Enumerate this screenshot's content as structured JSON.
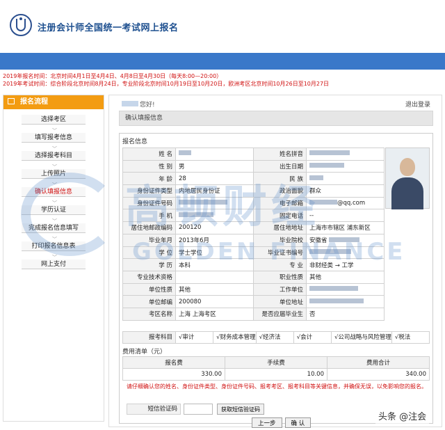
{
  "header": {
    "site_title": "注册会计师全国统一考试网上报名"
  },
  "notice": {
    "line1": "2019年报名时间：北京时间4月1日至4月4日、4月8日至4月30日（每天8:00—20:00）",
    "line2": "2019年考试时间：综合阶段北京时间8月24日，专业阶段北京时间10月19日至10月20日，欧洲考区北京时间10月26日至10月27日"
  },
  "sidebar": {
    "title": "报名流程",
    "steps": [
      "选择考区",
      "填写报考信息",
      "选择报考科目",
      "上传照片",
      "确认填报信息",
      "学历认证",
      "完成报名信息填写",
      "打印报名信息表",
      "网上支付"
    ],
    "active_index": 4
  },
  "main": {
    "greeting": "您好!",
    "logout": "退出登录",
    "confirm_title": "确认填报信息",
    "section_title": "报名信息",
    "fields": {
      "name_lbl": "姓 名",
      "pinyin_lbl": "姓名拼音",
      "gender_lbl": "性 别",
      "gender": "男",
      "dob_lbl": "出生日期",
      "age_lbl": "年 龄",
      "age": "28",
      "ethnic_lbl": "民 族",
      "idtype_lbl": "身份证件类型",
      "idtype": "内地居民身份证",
      "political_lbl": "政治面貌",
      "political": "群众",
      "idno_lbl": "身份证件号码",
      "email_lbl": "电子邮箱",
      "email_suffix": "@qq.com",
      "mobile_lbl": "手 机",
      "phone_lbl": "固定电话",
      "phone": "--",
      "zip_lbl": "居住地邮政编码",
      "zip": "200120",
      "addr_lbl": "居住地地址",
      "addr_prefix": "上海市市辖区 浦东新区",
      "grad_lbl": "毕业年月",
      "grad": "2013年6月",
      "school_lbl": "毕业院校",
      "school_prefix": "安徽省",
      "degree_lbl": "学 位",
      "degree": "学士学位",
      "cert_lbl": "毕业证书编号",
      "edu_lbl": "学 历",
      "edu": "本科",
      "major_lbl": "专 业",
      "major": "非财经类 → 工学",
      "title_lbl": "专业技术资格",
      "job_lbl": "职业性质",
      "job": "其他",
      "unit_type_lbl": "单位性质",
      "unit_type": "其他",
      "employer_lbl": "工作单位",
      "unit_zip_lbl": "单位邮编",
      "unit_zip": "200080",
      "unit_addr_lbl": "单位地址",
      "region_lbl": "考区名称",
      "region": "上海 上海考区",
      "fresh_lbl": "是否应届毕业生",
      "fresh": "否"
    },
    "exam": {
      "label": "报考科目",
      "subjects": [
        "√审计",
        "√财务成本管理",
        "√经济法",
        "√会计",
        "√公司战略与风险管理",
        "√税法"
      ]
    },
    "fee": {
      "title": "费用清单（元）",
      "headers": [
        "报名费",
        "手续费",
        "费用合计"
      ],
      "values": [
        "330.00",
        "10.00",
        "340.00"
      ]
    },
    "warning": "请仔细确认您的姓名、身份证件类型、身份证件号码、报考考区、报考科目等关键信息，并确保无误，以免影响您的报名。",
    "sms": {
      "label": "短信验证码",
      "value": "",
      "button": "获取短信验证码"
    },
    "buttons": {
      "prev": "上一步",
      "confirm": "确 认"
    }
  },
  "watermark": {
    "cn": "高顿财经",
    "en": "GOLDEN FINANCE"
  },
  "credit": "头条 @注会",
  "colors": {
    "accent": "#3a78c9",
    "sidebar_head": "#f39c12",
    "notice_red": "#d01010"
  }
}
